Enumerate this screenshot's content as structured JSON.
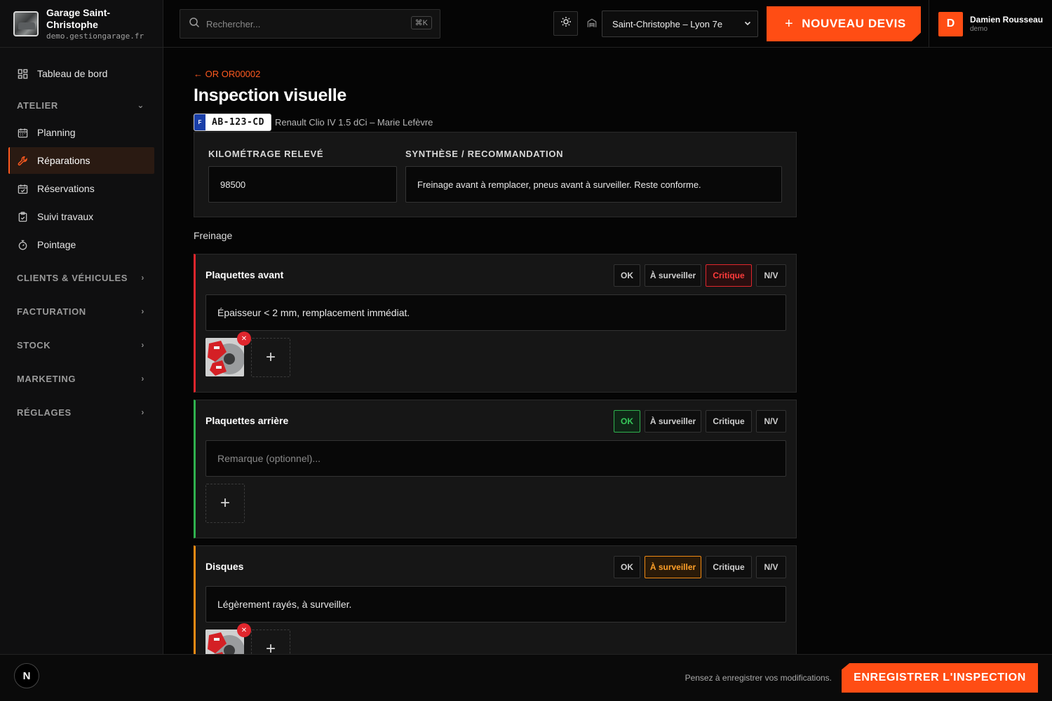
{
  "brand": {
    "name": "Garage Saint-Christophe",
    "domain": "demo.gestiongarage.fr"
  },
  "sidebar": {
    "dashboard": "Tableau de bord",
    "atelier_section": "ATELIER",
    "atelier_items": [
      {
        "label": "Planning",
        "icon": "calendar-icon"
      },
      {
        "label": "Réparations",
        "icon": "wrench-icon",
        "active": true
      },
      {
        "label": "Réservations",
        "icon": "calendar-check-icon"
      },
      {
        "label": "Suivi travaux",
        "icon": "clipboard-icon"
      },
      {
        "label": "Pointage",
        "icon": "stopwatch-icon"
      }
    ],
    "sections": [
      "CLIENTS & VÉHICULES",
      "FACTURATION",
      "STOCK",
      "MARKETING",
      "RÉGLAGES"
    ]
  },
  "topbar": {
    "search_placeholder": "Rechercher...",
    "shortcut": "⌘K",
    "branch": "Saint-Christophe – Lyon 7e",
    "new_quote": "NOUVEAU DEVIS",
    "user_initial": "D",
    "user_name": "Damien Rousseau",
    "user_role": "demo"
  },
  "page": {
    "back_link": "← OR OR00002",
    "title": "Inspection visuelle",
    "plate_country": "F",
    "plate": "AB-123-CD",
    "vehicle": "Renault Clio IV 1.5 dCi – Marie Lefèvre",
    "mileage_label": "KILOMÉTRAGE RELEVÉ",
    "mileage_value": "98500",
    "summary_label": "SYNTHÈSE / RECOMMANDATION",
    "summary_value": "Freinage avant à remplacer, pneus avant à surveiller. Reste conforme.",
    "group": "Freinage"
  },
  "status_labels": {
    "ok": "OK",
    "watch": "À surveiller",
    "critical": "Critique",
    "nv": "N/V"
  },
  "items": [
    {
      "name": "Plaquettes avant",
      "status": "critical",
      "remark": "Épaisseur < 2 mm, remplacement immédiat.",
      "photos": 1
    },
    {
      "name": "Plaquettes arrière",
      "status": "ok",
      "remark_placeholder": "Remarque (optionnel)...",
      "photos": 0
    },
    {
      "name": "Disques",
      "status": "watch",
      "remark": "Légèrement rayés, à surveiller.",
      "photos": 1
    }
  ],
  "bottom": {
    "next_badge": "N",
    "hint": "Pensez à enregistrer vos modifications.",
    "save": "ENREGISTRER L'INSPECTION"
  },
  "colors": {
    "accent": "#ff4d14",
    "critical": "#e0262d",
    "ok": "#2fb24e",
    "watch": "#f08a14"
  }
}
